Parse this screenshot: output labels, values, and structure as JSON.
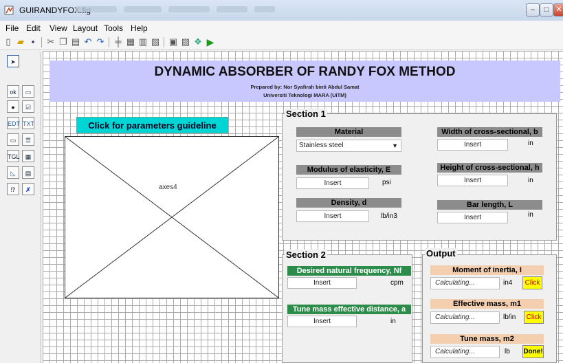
{
  "window": {
    "title": "GUIRANDYFOX.fig",
    "min": "–",
    "max": "□",
    "close": "✕"
  },
  "menu": [
    "File",
    "Edit",
    "View",
    "Layout",
    "Tools",
    "Help"
  ],
  "header": {
    "title": "DYNAMIC ABSORBER OF RANDY FOX METHOD",
    "prepared": "Prepared by: Nor Syafirah binti Abdul Samat",
    "university": "Universiti Teknologi MARA (UiTM)"
  },
  "guide_button": "Click for parameters guideline",
  "axes_label": "axes4",
  "section1": {
    "title": "Section 1",
    "material": {
      "label": "Material",
      "value": "Stainless steel"
    },
    "modulus": {
      "label": "Modulus of elasticity, E",
      "value": "Insert",
      "unit": "psi"
    },
    "density": {
      "label": "Density, d",
      "value": "Insert",
      "unit": "lb/in3"
    },
    "width": {
      "label": "Width of cross-sectional, b",
      "value": "Insert",
      "unit": "in"
    },
    "height": {
      "label": "Height of cross-sectional, h",
      "value": "Insert",
      "unit": "in"
    },
    "length": {
      "label": "Bar length, L",
      "value": "Insert",
      "unit": "in"
    }
  },
  "section2": {
    "title": "Section 2",
    "freq": {
      "label": "Desired natural frequency, Nf",
      "value": "Insert",
      "unit": "cpm"
    },
    "distance": {
      "label": "Tune mass effective distance, a",
      "value": "Insert",
      "unit": "in"
    }
  },
  "output": {
    "title": "Output",
    "inertia": {
      "label": "Moment of inertia, I",
      "value": "Calculating...",
      "unit": "in4",
      "button": "Click"
    },
    "m1": {
      "label": "Effective mass, m1",
      "value": "Calculating...",
      "unit": "lb/in",
      "button": "Click"
    },
    "m2": {
      "label": "Tune mass, m2",
      "value": "Calculating...",
      "unit": "lb",
      "button": "Done!"
    }
  },
  "colors": {
    "header": "#c8c8ff",
    "guide": "#00d5d5",
    "gray_label": "#8c8c8c",
    "green_label": "#2c8c4a",
    "peach_label": "#f3cfb0",
    "button": "#ffff00"
  }
}
